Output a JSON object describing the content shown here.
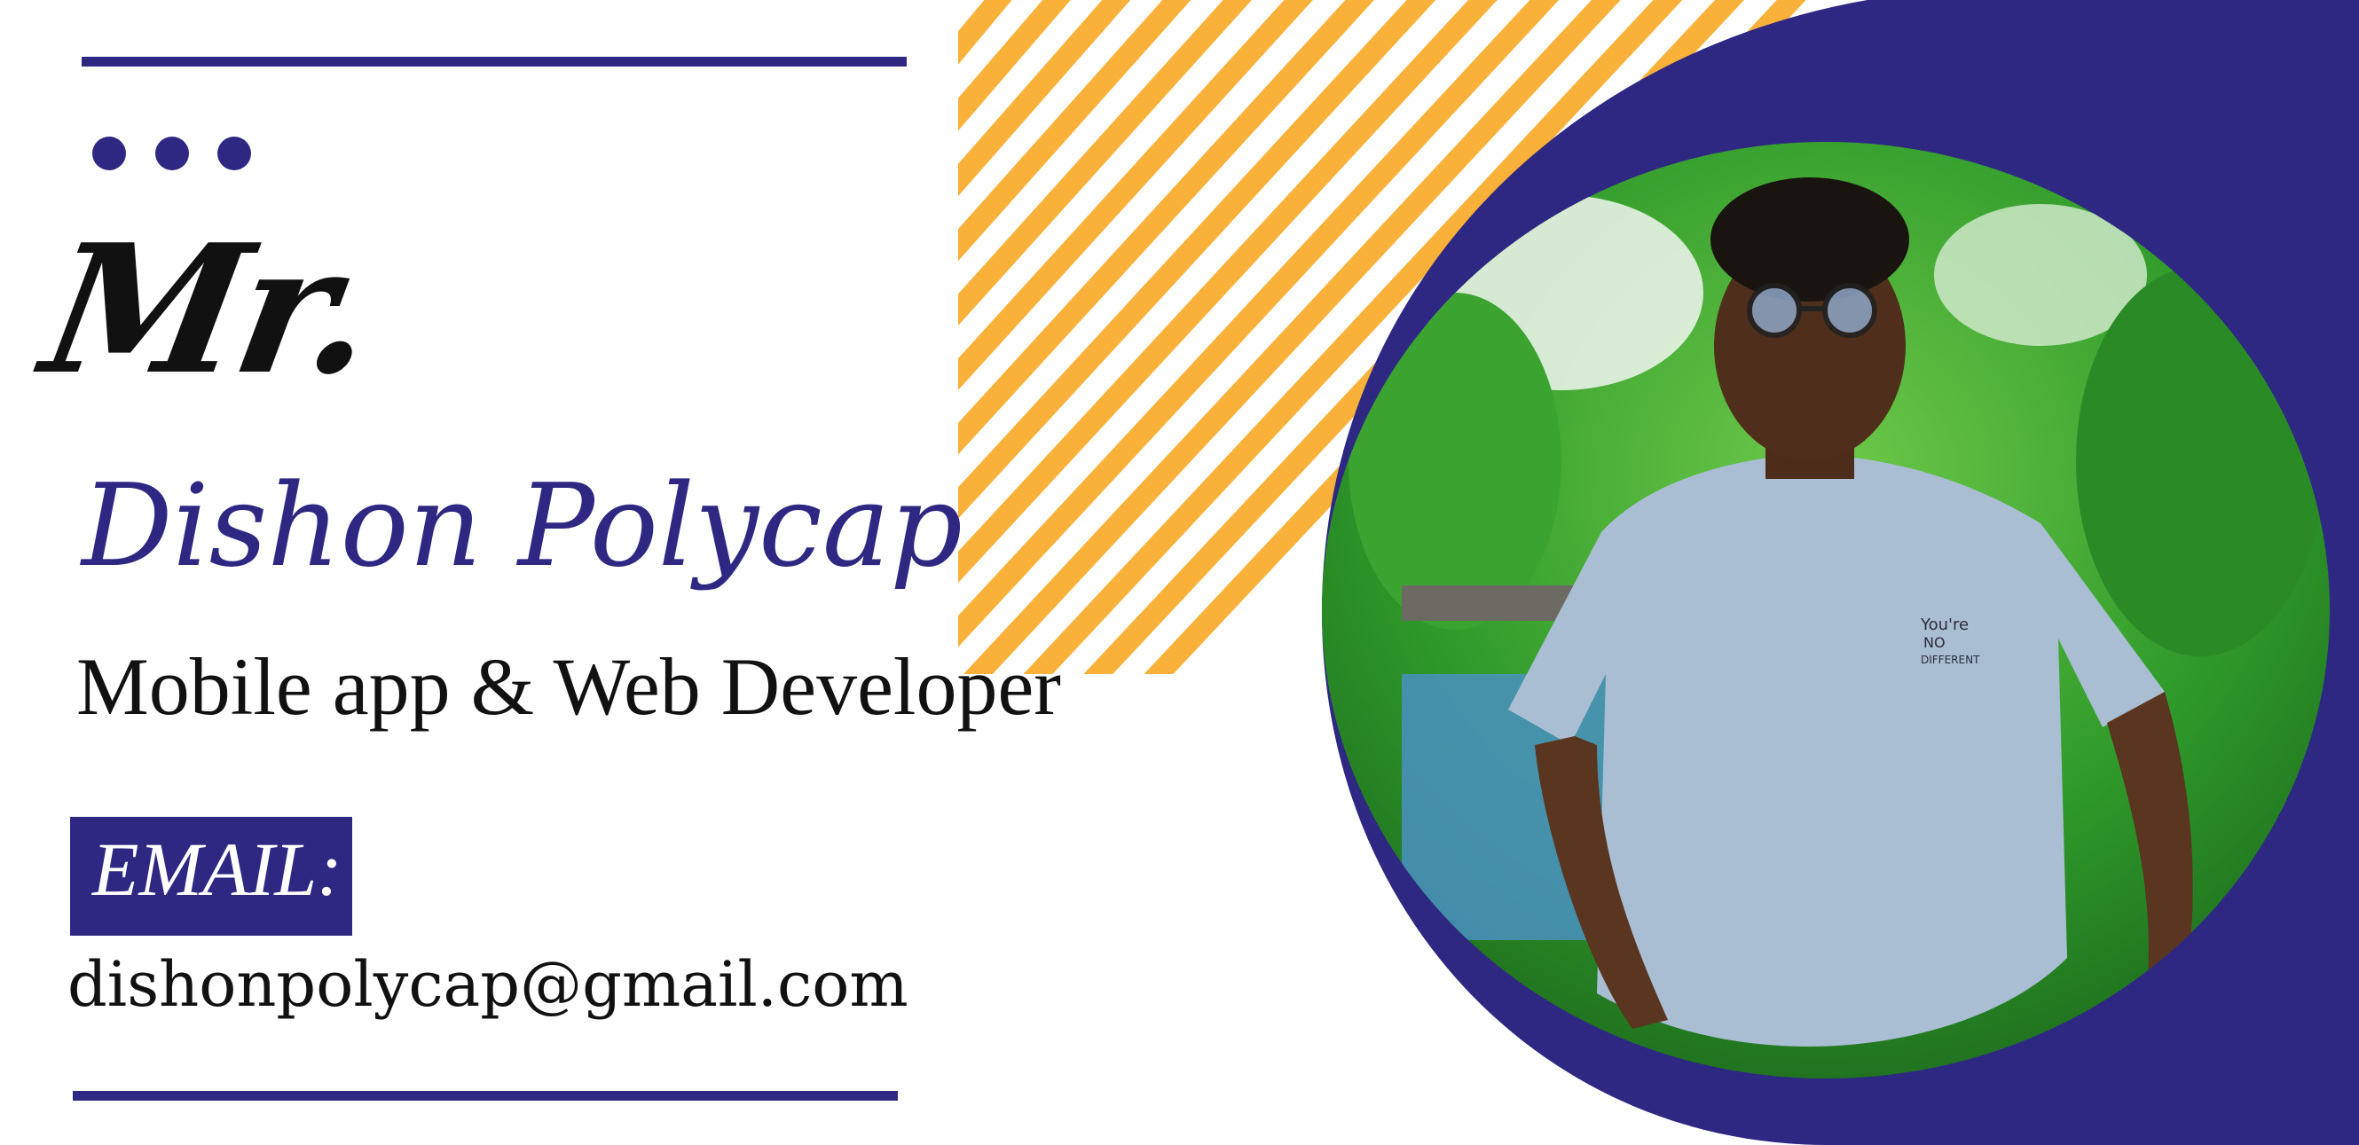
{
  "card": {
    "honorific": "Mr.",
    "name": "Dishon Polycap",
    "role": "Mobile app & Web Developer",
    "email_label": "EMAIL:",
    "email": "dishonpolycap@gmail.com"
  },
  "colors": {
    "navy": "#2e2883",
    "stripe_orange": "#f9b13a",
    "text_dark": "#111111",
    "background": "#ffffff"
  },
  "photo": {
    "description_icon": "portrait-photo",
    "shirt_print": "You're NO DIFFERENT"
  }
}
